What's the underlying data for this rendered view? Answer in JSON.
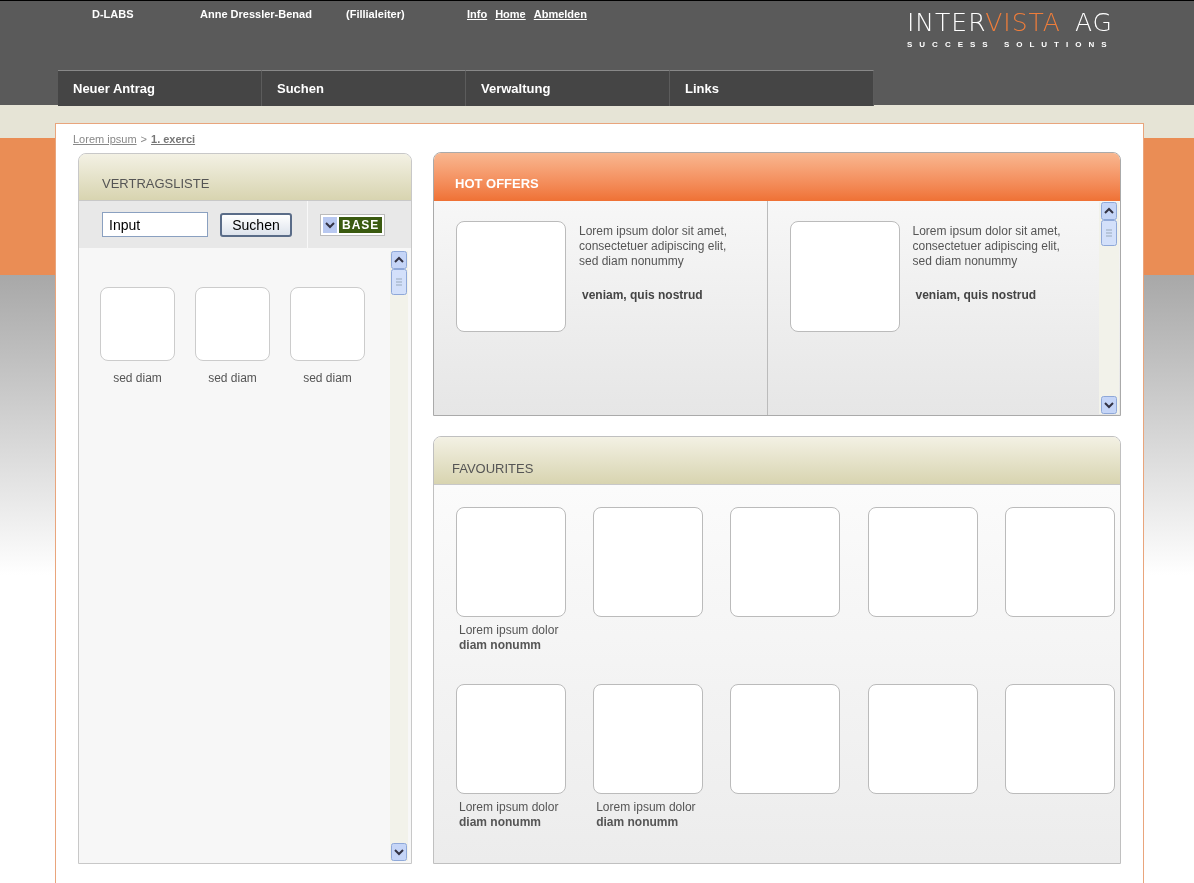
{
  "header": {
    "company": "D-LABS",
    "user": "Anne Dressler-Benad",
    "role": "(Fillialeiter)",
    "links": [
      "Info",
      "Home",
      "Abmelden"
    ],
    "logo": {
      "parts": [
        {
          "text": "INTER",
          "accent": false
        },
        {
          "text": "VISTA",
          "accent": true
        }
      ],
      "suffix": "AG",
      "tagline": "SUCCESS SOLUTIONS"
    }
  },
  "nav": [
    {
      "label": "Neuer Antrag"
    },
    {
      "label": "Suchen"
    },
    {
      "label": "Verwaltung"
    },
    {
      "label": "Links"
    }
  ],
  "breadcrumb": [
    {
      "label": "Lorem ipsum",
      "bold": false
    },
    {
      "label": "1. exerci",
      "bold": true
    }
  ],
  "breadcrumb_separator": ">",
  "vertragsliste": {
    "title": "VERTRAGSLISTE",
    "search": {
      "value": "Input"
    },
    "search_button": "Suchen",
    "dropdown": "BASE",
    "items": [
      {
        "caption": "sed diam"
      },
      {
        "caption": "sed diam"
      },
      {
        "caption": "sed diam"
      }
    ]
  },
  "hot_offers": {
    "title": "HOT OFFERS",
    "offers": [
      {
        "text": "Lorem ipsum dolor sit amet, consectetuer adipiscing elit, sed diam nonummy",
        "highlight": "veniam, quis nostrud"
      },
      {
        "text": "Lorem ipsum dolor sit amet, consectetuer adipiscing elit, sed diam nonummy",
        "highlight": "veniam, quis nostrud"
      }
    ]
  },
  "favourites": {
    "title": "FAVOURITES",
    "items": [
      {
        "kind": "captioned",
        "caption": "Lorem ipsum dolor",
        "subcaption": "diam nonumm"
      },
      {
        "kind": "plain"
      },
      {
        "kind": "plain"
      },
      {
        "kind": "plain"
      },
      {
        "kind": "plain"
      },
      {
        "kind": "captioned",
        "caption": "Lorem ipsum dolor",
        "subcaption": "diam nonumm"
      },
      {
        "kind": "captioned",
        "caption": "Lorem ipsum dolor",
        "subcaption": "diam nonumm"
      },
      {
        "kind": "plain"
      },
      {
        "kind": "plain"
      },
      {
        "kind": "plain"
      }
    ]
  }
}
